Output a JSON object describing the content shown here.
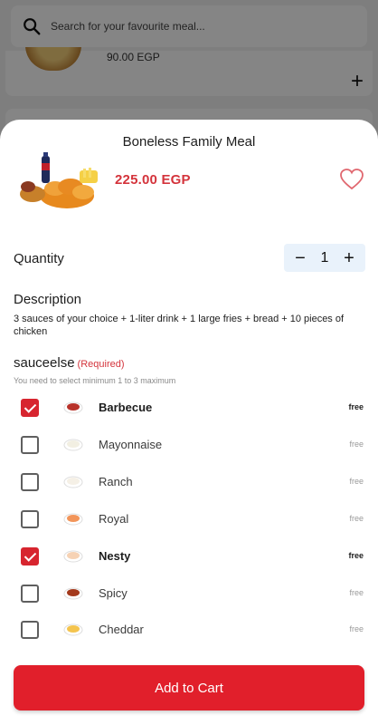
{
  "background": {
    "search": {
      "placeholder": "Search for your favourite meal...",
      "icon": "search-icon"
    },
    "card": {
      "price": "90.00 EGP",
      "add_icon": "plus-icon"
    }
  },
  "sheet": {
    "title": "Boneless Family Meal",
    "price": "225.00 EGP",
    "favorite_icon": "heart-outline-icon",
    "quantity": {
      "label": "Quantity",
      "value": "1",
      "decrement": "−",
      "increment": "+"
    },
    "description": {
      "heading": "Description",
      "text": "3 sauces of your choice + 1-liter drink + 1 large fries + bread + 10 pieces of chicken"
    },
    "option_group": {
      "name": "sauceelse",
      "required": "(Required)",
      "hint": "You need to select minimum 1  to  3 maximum",
      "options": [
        {
          "label": "Barbecue",
          "price": "free",
          "checked": true,
          "color": "#b8322a"
        },
        {
          "label": "Mayonnaise",
          "price": "free",
          "checked": false,
          "color": "#f2efe2"
        },
        {
          "label": "Ranch",
          "price": "free",
          "checked": false,
          "color": "#f5f0e6"
        },
        {
          "label": "Royal",
          "price": "free",
          "checked": false,
          "color": "#f2955a"
        },
        {
          "label": "Nesty",
          "price": "free",
          "checked": true,
          "color": "#f6d2b4"
        },
        {
          "label": "Spicy",
          "price": "free",
          "checked": false,
          "color": "#a3391c"
        },
        {
          "label": "Cheddar",
          "price": "free",
          "checked": false,
          "color": "#f4c44e"
        }
      ]
    },
    "cart_button": "Add to Cart"
  },
  "colors": {
    "accent": "#e11f2b",
    "price": "#d4343c",
    "stepper_bg": "#e9f2fb"
  }
}
